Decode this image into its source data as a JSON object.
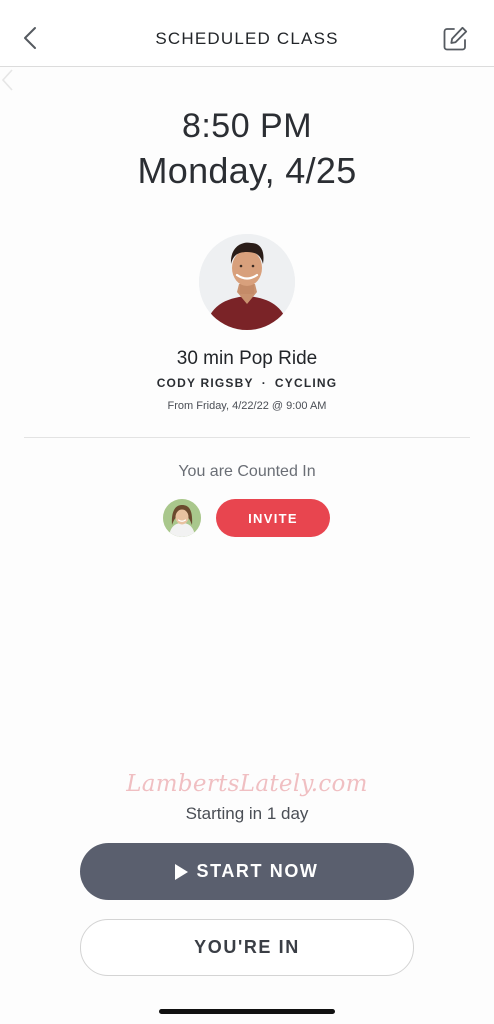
{
  "header": {
    "title": "SCHEDULED CLASS",
    "back_icon": "chevron-left-icon",
    "edit_icon": "edit-icon"
  },
  "schedule": {
    "time": "8:50 PM",
    "date": "Monday, 4/25"
  },
  "class": {
    "title": "30 min Pop Ride",
    "instructor": "CODY RIGSBY",
    "separator": "·",
    "discipline": "CYCLING",
    "from": "From Friday, 4/22/22 @ 9:00 AM"
  },
  "attendance": {
    "status": "You are Counted In",
    "invite_label": "INVITE"
  },
  "watermark": "LambertsLately.com",
  "footer": {
    "starting_text": "Starting in 1 day",
    "start_label": "START NOW",
    "youre_in_label": "YOU'RE IN"
  },
  "colors": {
    "invite": "#e8454f",
    "start_button": "#5a5f6e"
  }
}
